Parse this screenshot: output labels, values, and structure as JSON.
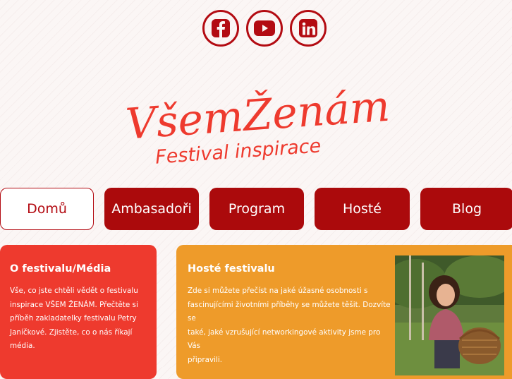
{
  "social": [
    {
      "name": "facebook-icon"
    },
    {
      "name": "youtube-icon"
    },
    {
      "name": "linkedin-icon"
    }
  ],
  "logo": {
    "line1": "VšemŽenám",
    "line2": "Festival inspirace"
  },
  "nav": [
    {
      "label": "Domů",
      "active": true
    },
    {
      "label": "Ambasadoři",
      "active": false
    },
    {
      "label": "Program",
      "active": false
    },
    {
      "label": "Hosté",
      "active": false
    },
    {
      "label": "Blog",
      "active": false
    }
  ],
  "cards": {
    "about": {
      "title": "O festivalu/Média",
      "lines": [
        "Vše, co jste chtěli vědět o festivalu",
        "inspirace VŠEM ŽENÁM. Přečtěte si",
        "příběh zakladatelky festivalu Petry",
        "Janíčkové. Zjistěte, co o nás říkají",
        "média."
      ]
    },
    "guests": {
      "title": "Hosté festivalu",
      "lines": [
        "Zde si můžete přečíst na jaké úžasné osobnosti s",
        "fascinujícími životními příběhy se můžete těšit. Dozvíte se",
        "také, jaké vzrušující networkingové aktivity jsme pro Vás",
        "připravili."
      ]
    }
  },
  "colors": {
    "brand_red": "#b30b12",
    "nav_red": "#ab0a0c",
    "card_red": "#ee3a2e",
    "card_orange": "#ee9b2a"
  }
}
